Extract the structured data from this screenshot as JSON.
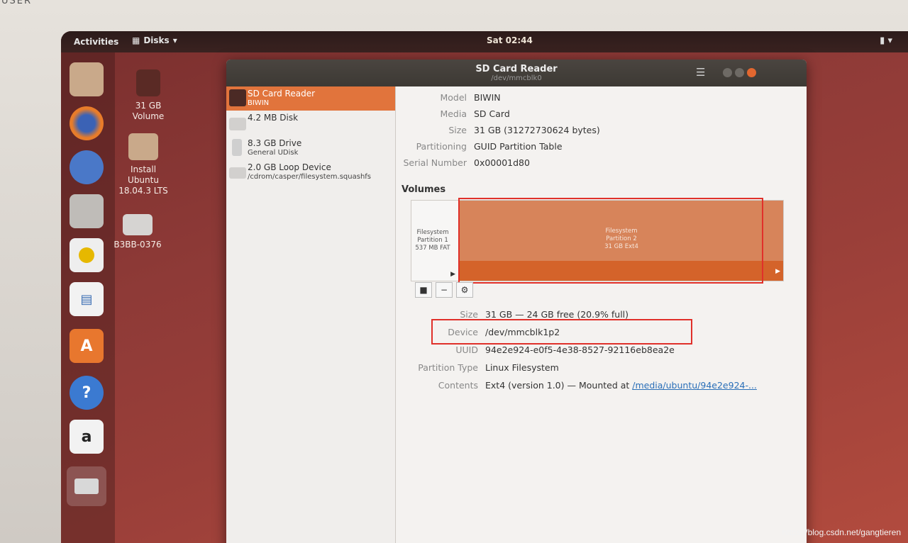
{
  "bezel": {
    "label": "USER"
  },
  "topbar": {
    "activities": "Activities",
    "app_menu": "Disks",
    "clock": "Sat 02:44"
  },
  "desktop_icons": [
    {
      "label_line1": "31 GB",
      "label_line2": "Volume"
    },
    {
      "label_line1": "Install",
      "label_line2": "Ubuntu",
      "label_line3": "18.04.3 LTS"
    },
    {
      "label_line1": "B3BB-0376"
    }
  ],
  "window": {
    "title": "SD Card Reader",
    "subtitle": "/dev/mmcblk0"
  },
  "devices": [
    {
      "name": "SD Card Reader",
      "sub": "BIWIN"
    },
    {
      "name": "4.2 MB Disk",
      "sub": ""
    },
    {
      "name": "8.3 GB Drive",
      "sub": "General UDisk"
    },
    {
      "name": "2.0 GB Loop Device",
      "sub": "/cdrom/casper/filesystem.squashfs"
    }
  ],
  "drive_info": {
    "model_label": "Model",
    "model_value": "BIWIN",
    "media_label": "Media",
    "media_value": "SD Card",
    "size_label": "Size",
    "size_value": "31 GB (31272730624 bytes)",
    "partitioning_label": "Partitioning",
    "partitioning_value": "GUID Partition Table",
    "serial_label": "Serial Number",
    "serial_value": "0x00001d80"
  },
  "volumes": {
    "heading": "Volumes",
    "partition1": {
      "line1": "Filesystem",
      "line2": "Partition 1",
      "line3": "537 MB FAT"
    },
    "partition2": {
      "line1": "Filesystem",
      "line2": "Partition 2",
      "line3": "31 GB Ext4"
    }
  },
  "volume_info": {
    "size_label": "Size",
    "size_value": "31 GB — 24 GB free (20.9% full)",
    "device_label": "Device",
    "device_value": "/dev/mmcblk1p2",
    "uuid_label": "UUID",
    "uuid_value": "94e2e924-e0f5-4e38-8527-92116eb8ea2e",
    "ptype_label": "Partition Type",
    "ptype_value": "Linux Filesystem",
    "contents_label": "Contents",
    "contents_value": "Ext4 (version 1.0) — Mounted at",
    "contents_link": "/media/ubuntu/94e2e924-..."
  },
  "watermark": "https://blog.csdn.net/gangtieren",
  "colors": {
    "accent": "#e1743c",
    "partition": "#d4632a",
    "annotation": "#e0302a"
  }
}
